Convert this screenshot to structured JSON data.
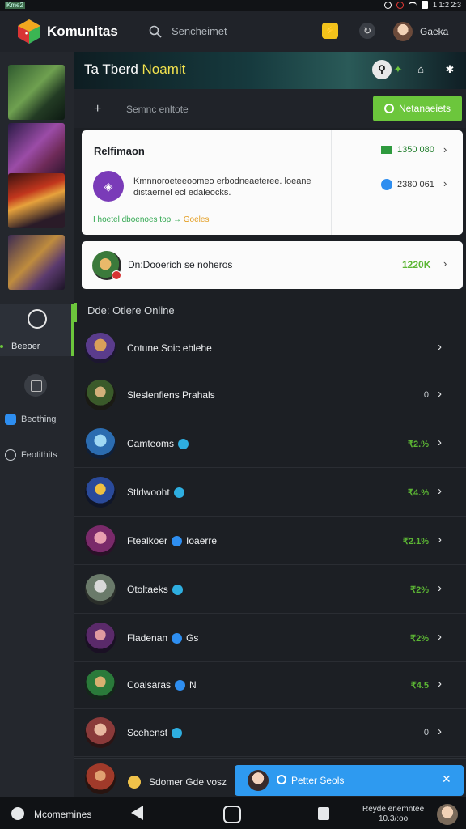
{
  "status_bar": {
    "left_badge": "Kme2",
    "right_text": "1 1:2 2:3"
  },
  "header": {
    "app_title": "Komunitas",
    "search_placeholder": "Sencheimet",
    "user_name": "Gaeka"
  },
  "banner": {
    "title_prefix": "Ta Tberd",
    "title_accent": "Noamit"
  },
  "toolbar": {
    "text": "Semnc enltote",
    "button_label": "Netanaeiets"
  },
  "featured": {
    "title": "Relfimaon",
    "description": "Kmnnoroeteeoomeo erbodneaeteree. loeane distaernel ecl edaleocks.",
    "link_text": "I hoetel dboenoes top →",
    "link_accent": "Goeles",
    "stat_1": "1350 080",
    "stat_2": "2380 061"
  },
  "group_card": {
    "label": "Dn:Dooerich se noheros",
    "value": "1220K"
  },
  "online_section": {
    "title": "Dde: Otlere Online"
  },
  "online_list": [
    {
      "name": "Cotune Soic ehlehe",
      "value": "",
      "verified": false
    },
    {
      "name": "Sleslenfiens Prahals",
      "value": "0",
      "verified": false
    },
    {
      "name": "Camteoms",
      "value": "₹2.%",
      "verified": true
    },
    {
      "name": "Stlrlwooht",
      "value": "₹4.%",
      "verified": true
    },
    {
      "name": "Ftealkoer",
      "suffix": "Ioaerre",
      "value": "₹2.1%",
      "verified": true
    },
    {
      "name": "Otoltaeks",
      "value": "₹2%",
      "verified": true
    },
    {
      "name": "Fladenan",
      "suffix": "Gs",
      "value": "₹2%",
      "verified": true
    },
    {
      "name": "Coalsaras",
      "suffix": "N",
      "value": "₹4.5",
      "verified": true
    },
    {
      "name": "Scehenst",
      "value": "0",
      "verified": true
    }
  ],
  "chat_bar": {
    "text": "Sdomer Gde vosz"
  },
  "toast": {
    "text": "Petter Seols"
  },
  "rail": {
    "active_label": "Beeoer",
    "item_1": "Beothing",
    "item_2": "Feotithits"
  },
  "nav_bar": {
    "label": "Mcomemines",
    "user_line_1": "Reyde enemntee",
    "user_line_2": "10.3/:oo"
  }
}
